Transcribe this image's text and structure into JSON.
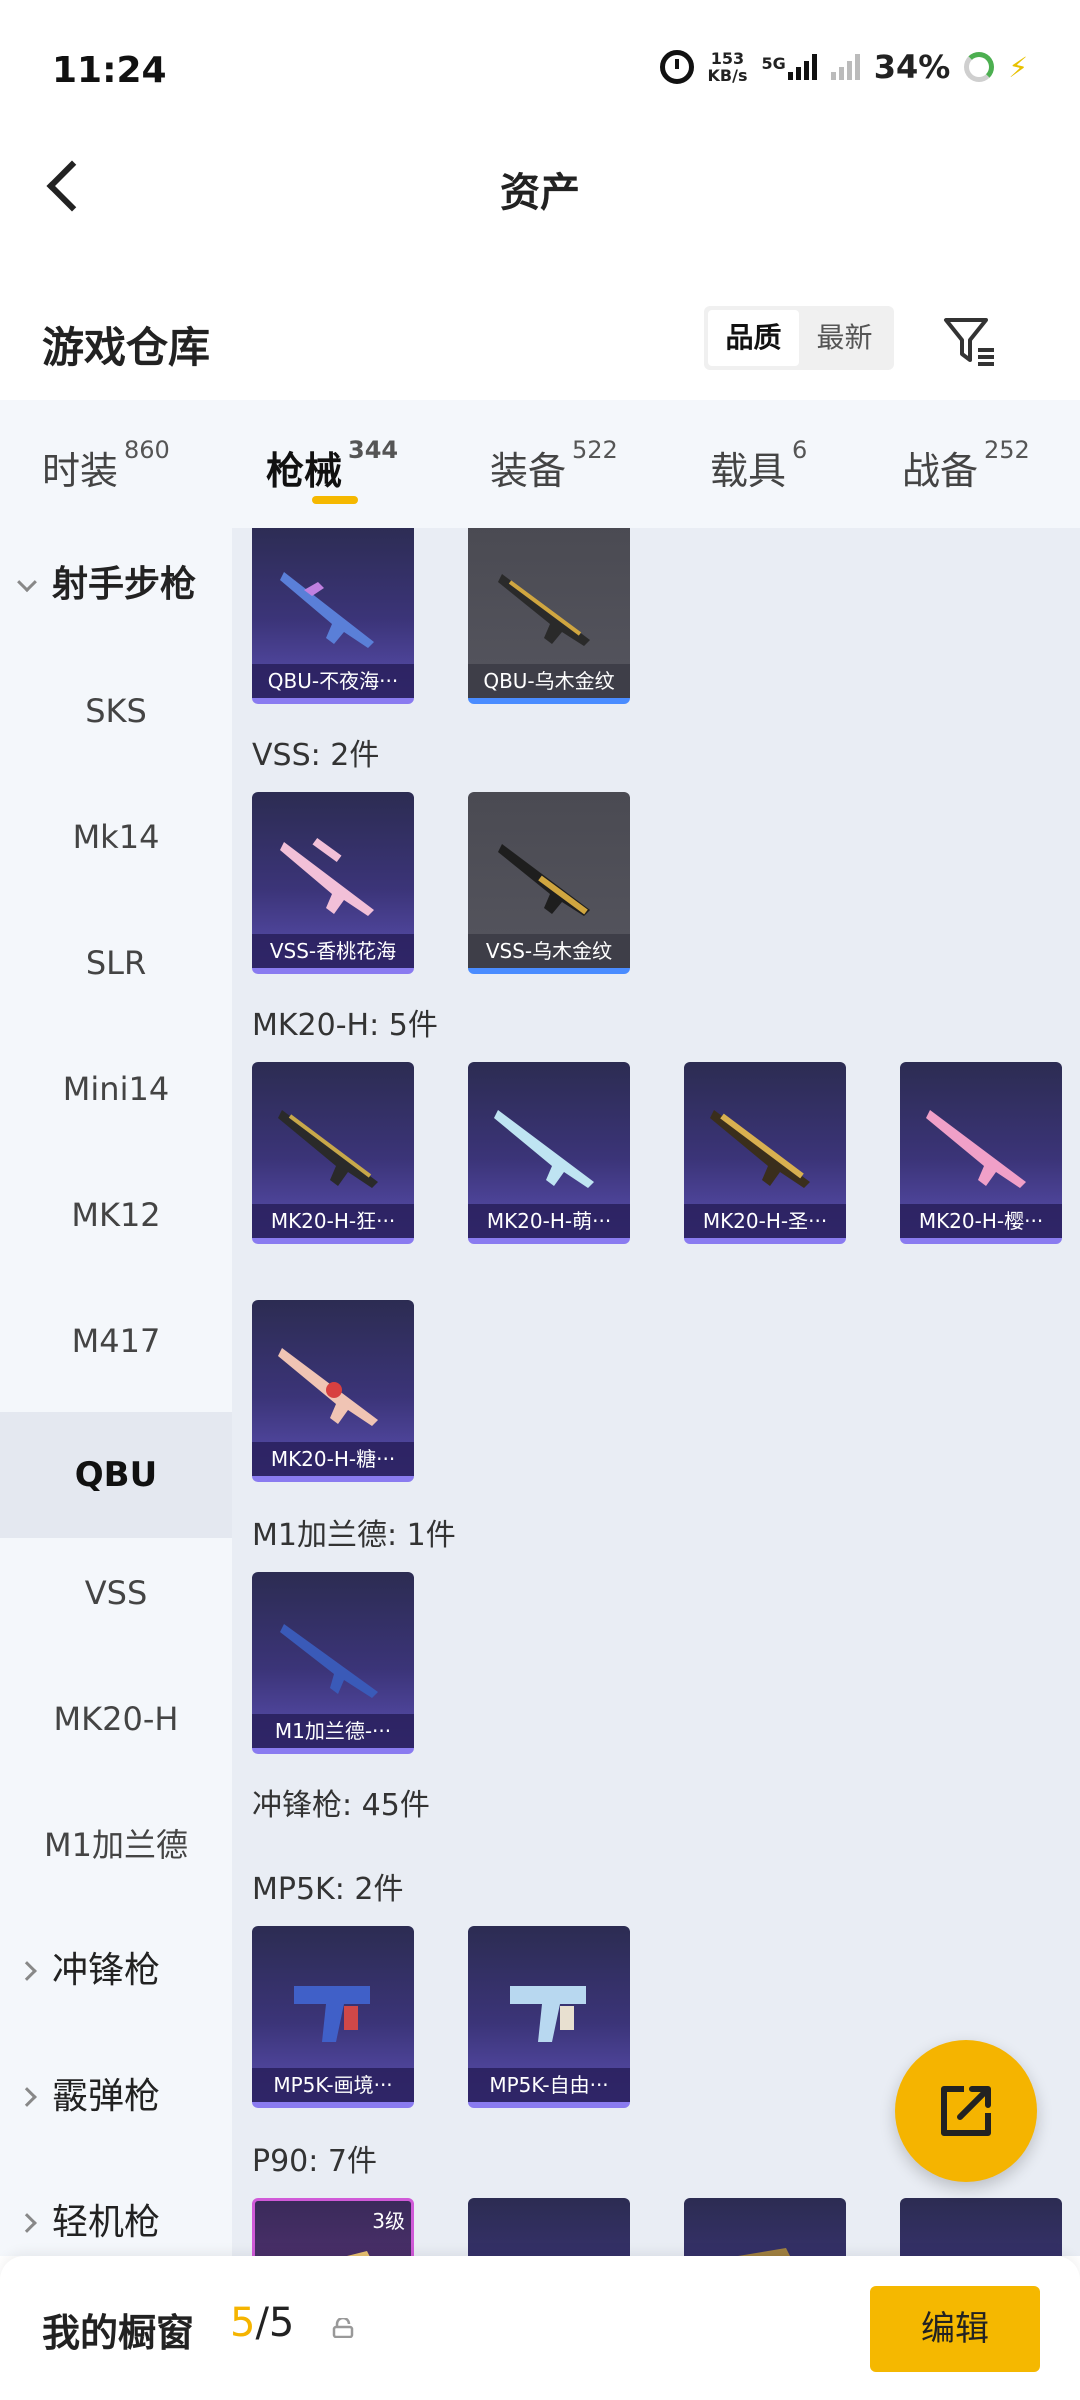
{
  "status": {
    "time": "11:24",
    "net_speed_value": "153",
    "net_speed_unit": "KB/s",
    "network": "5G",
    "battery": "34%"
  },
  "header": {
    "title": "资产"
  },
  "warehouse": {
    "title": "游戏仓库",
    "sort_options": [
      "品质",
      "最新"
    ],
    "sort_selected": "品质"
  },
  "tabs": [
    {
      "label": "时装",
      "count": "860"
    },
    {
      "label": "枪械",
      "count": "344"
    },
    {
      "label": "装备",
      "count": "522"
    },
    {
      "label": "载具",
      "count": "6"
    },
    {
      "label": "战备",
      "count": "252"
    }
  ],
  "sidebar": [
    {
      "label": "射手步枪",
      "type": "group",
      "expanded": true
    },
    {
      "label": "SKS",
      "type": "item"
    },
    {
      "label": "Mk14",
      "type": "item"
    },
    {
      "label": "SLR",
      "type": "item"
    },
    {
      "label": "Mini14",
      "type": "item"
    },
    {
      "label": "MK12",
      "type": "item"
    },
    {
      "label": "M417",
      "type": "item"
    },
    {
      "label": "QBU",
      "type": "item",
      "selected": true
    },
    {
      "label": "VSS",
      "type": "item"
    },
    {
      "label": "MK20-H",
      "type": "item"
    },
    {
      "label": "M1加兰德",
      "type": "item"
    },
    {
      "label": "冲锋枪",
      "type": "group",
      "expanded": false
    },
    {
      "label": "霰弹枪",
      "type": "group",
      "expanded": false
    },
    {
      "label": "轻机枪",
      "type": "group",
      "expanded": false
    }
  ],
  "content": {
    "qbu_items": [
      "QBU-不夜海···",
      "QBU-乌木金纹"
    ],
    "vss_title": "VSS: 2件",
    "vss_items": [
      "VSS-香桃花海",
      "VSS-乌木金纹"
    ],
    "mk20_title": "MK20-H: 5件",
    "mk20_items": [
      "MK20-H-狂···",
      "MK20-H-萌···",
      "MK20-H-圣···",
      "MK20-H-樱···",
      "MK20-H-糖···"
    ],
    "m1_title": "M1加兰德: 1件",
    "m1_items": [
      "M1加兰德-···"
    ],
    "smg_title": "冲锋枪: 45件",
    "mp5k_title": "MP5K: 2件",
    "mp5k_items": [
      "MP5K-画境···",
      "MP5K-自由···"
    ],
    "p90_title": "P90: 7件",
    "p90_badge": "3级"
  },
  "showcase": {
    "label": "我的橱窗",
    "current": "5",
    "total": "/5"
  },
  "edit_label": "编辑",
  "colors": {
    "accent": "#f5b800",
    "card_purple": "#3b3478",
    "card_gray": "#55555e"
  }
}
